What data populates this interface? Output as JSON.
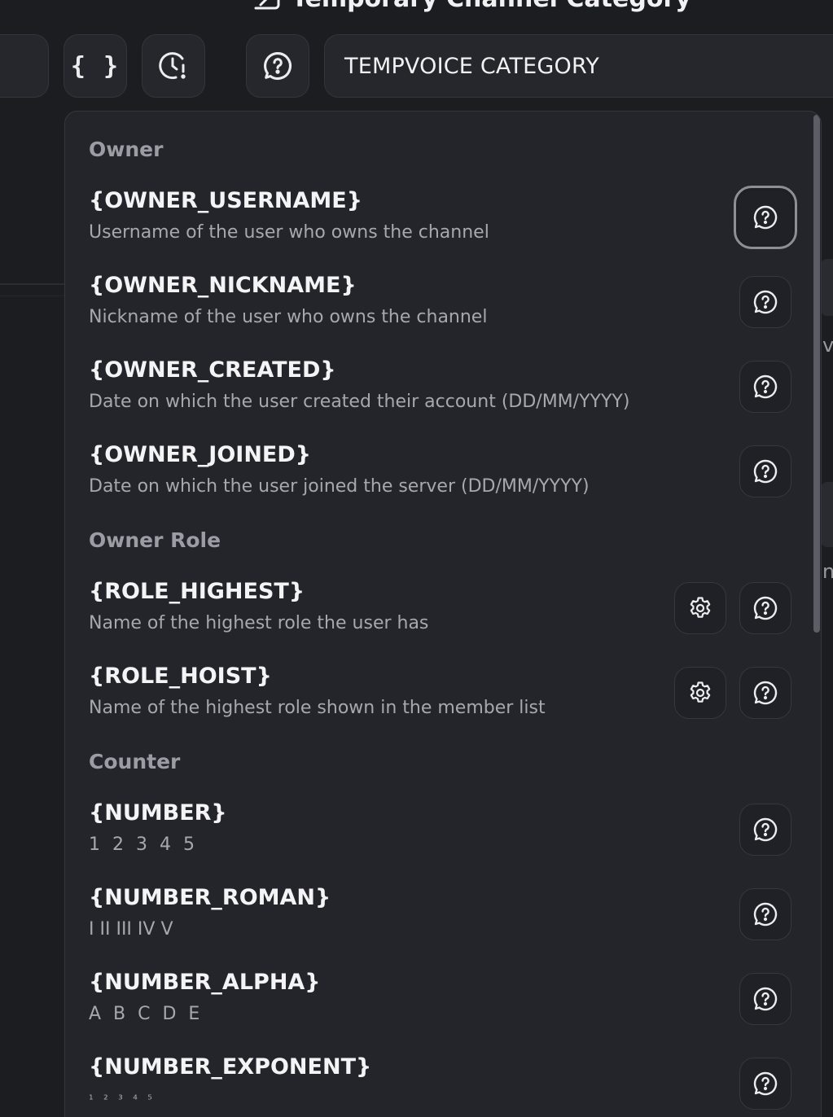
{
  "header": {
    "title": "Temporary Channel Category"
  },
  "toolbar": {
    "braces_label": "{ }",
    "name_value": "TEMPVOICE CATEGORY"
  },
  "background_fragments": [
    "va",
    "ne"
  ],
  "variables_menu": {
    "sections": [
      {
        "title": "Owner",
        "items": [
          {
            "name": "{OWNER_USERNAME}",
            "description": "Username of the user who owns the channel"
          },
          {
            "name": "{OWNER_NICKNAME}",
            "description": "Nickname of the user who owns the channel"
          },
          {
            "name": "{OWNER_CREATED}",
            "description": "Date on which the user created their account (DD/MM/YYYY)"
          },
          {
            "name": "{OWNER_JOINED}",
            "description": "Date on which the user joined the server (DD/MM/YYYY)"
          }
        ]
      },
      {
        "title": "Owner Role",
        "items": [
          {
            "name": "{ROLE_HIGHEST}",
            "description": "Name of the highest role the user has"
          },
          {
            "name": "{ROLE_HOIST}",
            "description": "Name of the highest role shown in the member list"
          }
        ]
      },
      {
        "title": "Counter",
        "items": [
          {
            "name": "{NUMBER}",
            "description": "1 2 3 4 5"
          },
          {
            "name": "{NUMBER_ROMAN}",
            "description": "I II III IV V"
          },
          {
            "name": "{NUMBER_ALPHA}",
            "description": "A B C D E"
          },
          {
            "name": "{NUMBER_EXPONENT}",
            "description": "¹ ² ³ ⁴ ⁵"
          }
        ]
      }
    ]
  },
  "icons": {
    "help": "help-chat-icon",
    "settings": "gear-icon",
    "clock": "clock-alert-icon",
    "title": "channel-enter-icon"
  }
}
